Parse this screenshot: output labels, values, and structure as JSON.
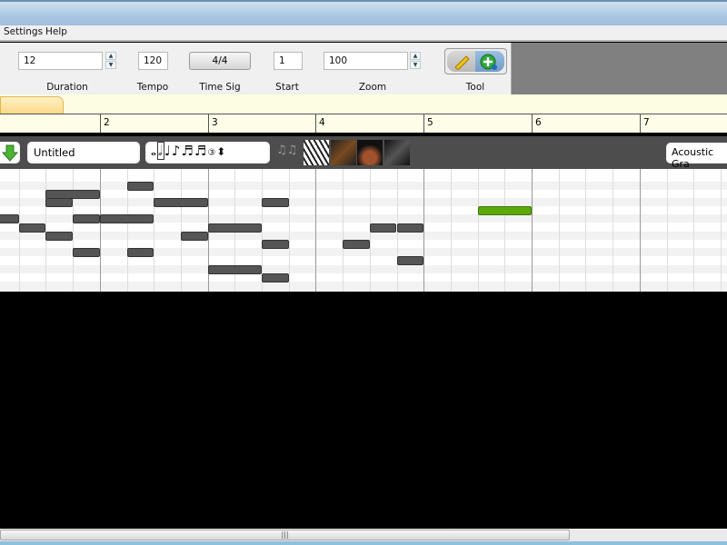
{
  "menu": {
    "items": [
      "Settings",
      "Help"
    ]
  },
  "toolbar": {
    "duration": {
      "label": "Duration",
      "value": "12"
    },
    "tempo": {
      "label": "Tempo",
      "value": "120"
    },
    "time_sig": {
      "label": "Time Sig",
      "value": "4/4"
    },
    "start": {
      "label": "Start",
      "value": "1"
    },
    "zoom": {
      "label": "Zoom",
      "value": "100"
    },
    "tool": {
      "label": "Tool",
      "options": [
        "pencil-icon",
        "add-note-icon"
      ],
      "selected": "add-note-icon"
    }
  },
  "ruler": {
    "measures": [
      "2",
      "3",
      "4",
      "5",
      "6",
      "7"
    ]
  },
  "track": {
    "name": "Untitled",
    "instrument": "Acoustic Gra",
    "note_values": [
      "whole",
      "half",
      "quarter",
      "eighth",
      "sixteenth",
      "thirty-second",
      "triplet"
    ],
    "instrument_icons": [
      "notes-icon",
      "piano-icon",
      "guitar-icon",
      "drum-icon",
      "bass-icon"
    ]
  },
  "colors": {
    "note": "#555555",
    "selected_note": "#5aa80a",
    "tab": "#fcd98a",
    "ruler": "#fefee8"
  },
  "notes": [
    {
      "beat": 2,
      "dur": 2,
      "row": 1
    },
    {
      "beat": 2,
      "dur": 1,
      "row": 2
    },
    {
      "beat": 5,
      "dur": 1,
      "row": 0
    },
    {
      "beat": 6,
      "dur": 2,
      "row": 2
    },
    {
      "beat": 10,
      "dur": 1,
      "row": 2
    },
    {
      "beat": 0,
      "dur": 1,
      "row": 4
    },
    {
      "beat": 1,
      "dur": 1,
      "row": 5
    },
    {
      "beat": 2,
      "dur": 1,
      "row": 6
    },
    {
      "beat": 3,
      "dur": 1,
      "row": 4
    },
    {
      "beat": 4,
      "dur": 2,
      "row": 4
    },
    {
      "beat": 7,
      "dur": 1,
      "row": 6
    },
    {
      "beat": 8,
      "dur": 2,
      "row": 5
    },
    {
      "beat": 10,
      "dur": 1,
      "row": 7
    },
    {
      "beat": 3,
      "dur": 1,
      "row": 8
    },
    {
      "beat": 5,
      "dur": 1,
      "row": 8
    },
    {
      "beat": 8,
      "dur": 2,
      "row": 10
    },
    {
      "beat": 10,
      "dur": 1,
      "row": 11
    },
    {
      "beat": 13,
      "dur": 1,
      "row": 7
    },
    {
      "beat": 14,
      "dur": 1,
      "row": 5
    },
    {
      "beat": 15,
      "dur": 1,
      "row": 5
    },
    {
      "beat": 15,
      "dur": 1,
      "row": 9
    },
    {
      "beat": 18,
      "dur": 2,
      "row": 3,
      "selected": true
    }
  ]
}
